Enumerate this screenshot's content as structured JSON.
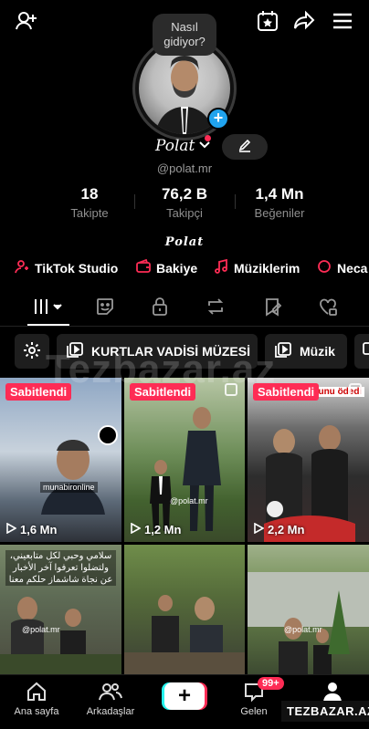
{
  "profile": {
    "bubble_text": "Nasıl gidiyor?",
    "name": "Polat",
    "handle": "@polat.mr",
    "bio": "Polat"
  },
  "stats": [
    {
      "value": "18",
      "label": "Takipte"
    },
    {
      "value": "76,2 B",
      "label": "Takipçi"
    },
    {
      "value": "1,4 Mn",
      "label": "Beğeniler"
    }
  ],
  "quick_links": [
    {
      "label": "TikTok Studio",
      "icon": "person-studio-icon"
    },
    {
      "label": "Bakiye",
      "icon": "wallet-icon"
    },
    {
      "label": "Müziklerim",
      "icon": "music-note-icon"
    },
    {
      "label": "Neca",
      "icon": "chat-icon"
    }
  ],
  "chips": {
    "playlist1": "KURTLAR VADİSİ MÜZESİ",
    "playlist2": "Müzik"
  },
  "videos": [
    {
      "pinned": "Sabitlendi",
      "views": "1,6 Mn",
      "caption": "munabironline"
    },
    {
      "pinned": "Sabitlendi",
      "views": "1,2 Mn",
      "caption": "@polat.mr"
    },
    {
      "pinned": "Sabitlendi",
      "views": "2,2 Mn",
      "caption": "vefa borcunu ödedi"
    },
    {
      "arabic": "سلامي وحبي لكل متابعيني، ولتضلوا تعرفوا آخر الأخبار عن نجاة شاشماز حلكم معنا",
      "caption": "@polat.mr"
    },
    {
      "caption": ""
    },
    {
      "caption": "@polat.mr"
    }
  ],
  "watermark": "Tezbazar.az",
  "bottom_nav": {
    "home": "Ana sayfa",
    "friends": "Arkadaşlar",
    "inbox": "Gelen",
    "inbox_badge": "99+",
    "stamp": "TEZBAZAR.AZ"
  },
  "colors": {
    "accent": "#fe2c55",
    "blue": "#20a3ee",
    "cyan": "#25f4ee"
  }
}
